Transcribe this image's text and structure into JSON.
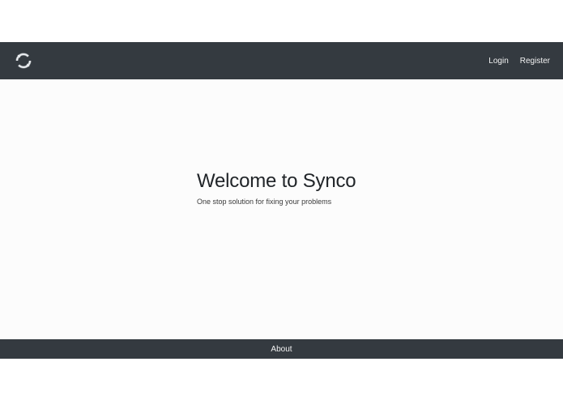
{
  "navbar": {
    "logo_icon": "sync-arrows-icon",
    "links": [
      {
        "label": "Login"
      },
      {
        "label": "Register"
      }
    ],
    "background": "#343a40"
  },
  "hero": {
    "title": "Welcome to Synco",
    "subtitle": "One stop solution for fixing your problems"
  },
  "footer": {
    "about_label": "About"
  }
}
